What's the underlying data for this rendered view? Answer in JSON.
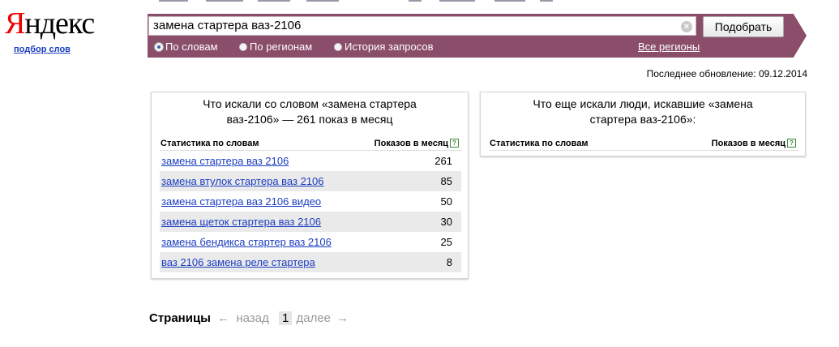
{
  "logo": {
    "first_letter": "Я",
    "rest": "ндекс",
    "subtitle": "подбор слов"
  },
  "search": {
    "query": "замена стартера ваз-2106",
    "clear_glyph": "×",
    "submit_label": "Подобрать"
  },
  "modes": [
    {
      "label": "По словам",
      "selected": true
    },
    {
      "label": "По регионам",
      "selected": false
    },
    {
      "label": "История запросов",
      "selected": false
    }
  ],
  "all_regions_label": "Все регионы",
  "last_update": "Последнее обновление: 09.12.2014",
  "left_panel": {
    "title_line1": "Что искали со словом «замена стартера",
    "title_line2": "ваз-2106» — 261 показ в месяц",
    "col_words": "Статистика по словам",
    "col_shows": "Показов в месяц",
    "help_glyph": "?",
    "rows": [
      {
        "keyword": "замена стартера ваз 2106",
        "count": "261"
      },
      {
        "keyword": "замена втулок стартера ваз 2106",
        "count": "85"
      },
      {
        "keyword": "замена стартера ваз 2106 видео",
        "count": "50"
      },
      {
        "keyword": "замена щеток стартера ваз 2106",
        "count": "30"
      },
      {
        "keyword": "замена бендикса стартер ваз 2106",
        "count": "25"
      },
      {
        "keyword": "ваз 2106 замена реле стартера",
        "count": "8"
      }
    ]
  },
  "right_panel": {
    "title_line1": "Что еще искали люди, искавшие «замена",
    "title_line2": "стартера ваз-2106»:",
    "col_words": "Статистика по словам",
    "col_shows": "Показов в месяц",
    "help_glyph": "?"
  },
  "pager": {
    "label": "Страницы",
    "prev_arrow": "←",
    "prev": "назад",
    "current": "1",
    "next": "далее",
    "next_arrow": "→"
  },
  "colors": {
    "bar": "#8a4d6a",
    "link": "#1a3dc1",
    "logo_red": "#ee0000"
  }
}
